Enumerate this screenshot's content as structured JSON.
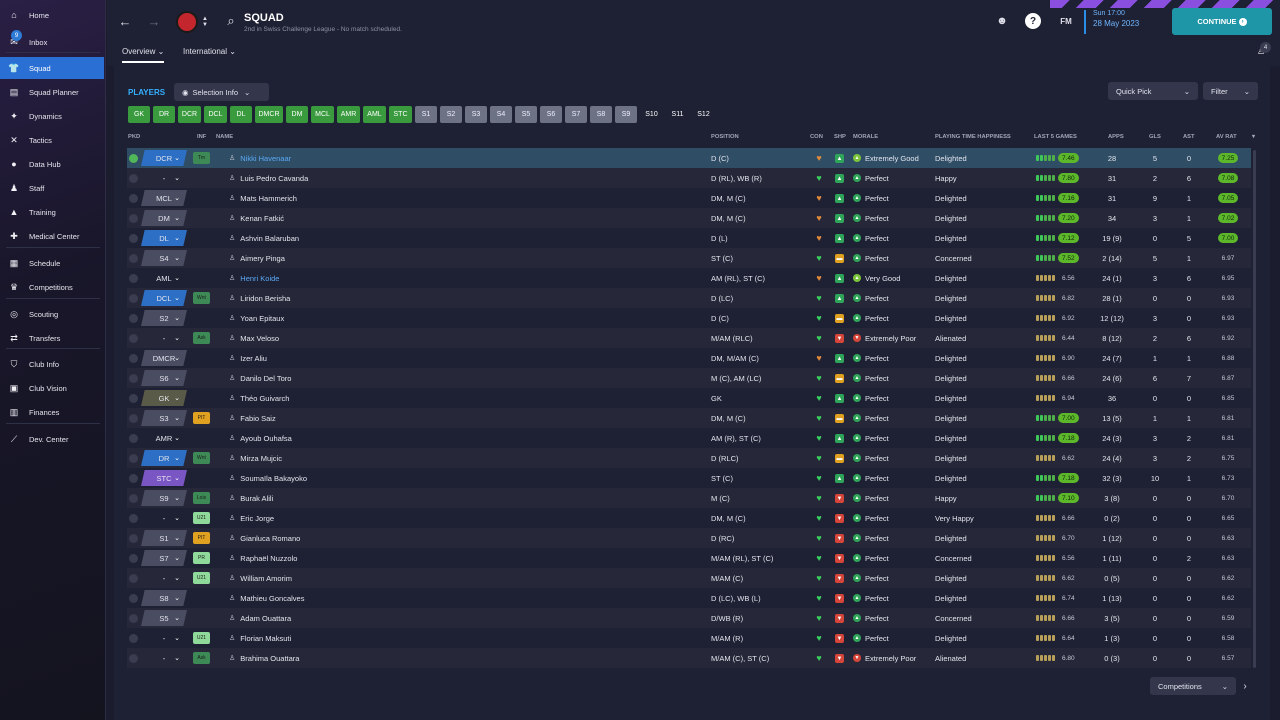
{
  "sidebar": {
    "items": [
      {
        "label": "Home",
        "icon": "home-icon",
        "glyph": "⌂"
      },
      {
        "label": "Inbox",
        "icon": "inbox-icon",
        "glyph": "✉",
        "badge": "9"
      },
      {
        "label": "Squad",
        "icon": "shirt-icon",
        "glyph": "👕",
        "active": true
      },
      {
        "label": "Squad Planner",
        "icon": "planner-icon",
        "glyph": "▤"
      },
      {
        "label": "Dynamics",
        "icon": "dynamics-icon",
        "glyph": "✦"
      },
      {
        "label": "Tactics",
        "icon": "tactics-icon",
        "glyph": "✕"
      },
      {
        "label": "Data Hub",
        "icon": "data-hub-icon",
        "glyph": "●"
      },
      {
        "label": "Staff",
        "icon": "staff-icon",
        "glyph": "♟"
      },
      {
        "label": "Training",
        "icon": "training-icon",
        "glyph": "▲"
      },
      {
        "label": "Medical Center",
        "icon": "medical-icon",
        "glyph": "✚"
      },
      {
        "label": "Schedule",
        "icon": "calendar-icon",
        "glyph": "▦"
      },
      {
        "label": "Competitions",
        "icon": "trophy-icon",
        "glyph": "♛"
      },
      {
        "label": "Scouting",
        "icon": "scouting-icon",
        "glyph": "◎"
      },
      {
        "label": "Transfers",
        "icon": "transfers-icon",
        "glyph": "⇄"
      },
      {
        "label": "Club Info",
        "icon": "shield-icon",
        "glyph": "⛉"
      },
      {
        "label": "Club Vision",
        "icon": "vision-icon",
        "glyph": "▣"
      },
      {
        "label": "Finances",
        "icon": "finances-icon",
        "glyph": "▥"
      },
      {
        "label": "Dev. Center",
        "icon": "dev-center-icon",
        "glyph": "⟋"
      }
    ]
  },
  "header": {
    "title": "SQUAD",
    "subtitle": "2nd in Swiss Challenge League - No match scheduled.",
    "tabs": [
      "Overview",
      "International"
    ],
    "fm_label": "FM",
    "date_day": "Sun 17:00",
    "date": "28 May 2023",
    "continue_label": "CONTINUE",
    "notification_count": "4"
  },
  "toolbar": {
    "players_label": "PLAYERS",
    "selection_info": "Selection Info",
    "quick_pick": "Quick Pick",
    "filter": "Filter",
    "competitions": "Competitions"
  },
  "position_chips": [
    {
      "label": "GK",
      "style": "g"
    },
    {
      "label": "DR",
      "style": "g"
    },
    {
      "label": "DCR",
      "style": "g"
    },
    {
      "label": "DCL",
      "style": "g"
    },
    {
      "label": "DL",
      "style": "g"
    },
    {
      "label": "DMCR",
      "style": "g"
    },
    {
      "label": "DM",
      "style": "g"
    },
    {
      "label": "MCL",
      "style": "g"
    },
    {
      "label": "AMR",
      "style": "g"
    },
    {
      "label": "AML",
      "style": "g"
    },
    {
      "label": "STC",
      "style": "g"
    },
    {
      "label": "S1",
      "style": "s"
    },
    {
      "label": "S2",
      "style": "s"
    },
    {
      "label": "S3",
      "style": "s"
    },
    {
      "label": "S4",
      "style": "s"
    },
    {
      "label": "S5",
      "style": "s"
    },
    {
      "label": "S6",
      "style": "s"
    },
    {
      "label": "S7",
      "style": "s"
    },
    {
      "label": "S8",
      "style": "s"
    },
    {
      "label": "S9",
      "style": "s"
    },
    {
      "label": "S10",
      "style": "n"
    },
    {
      "label": "S11",
      "style": "n"
    },
    {
      "label": "S12",
      "style": "n"
    }
  ],
  "columns": {
    "pkd": "PKD",
    "inf": "INF",
    "name": "NAME",
    "position": "POSITION",
    "con": "CON",
    "shp": "SHP",
    "morale": "MORALE",
    "happiness": "PLAYING TIME HAPPINESS",
    "last5": "LAST 5 GAMES",
    "apps": "APPS",
    "gls": "GLS",
    "ast": "AST",
    "avrat": "AV RAT"
  },
  "players": [
    {
      "tag": "DCR",
      "tag_color": "#2d6fc4",
      "inf": "Trn",
      "inf_color": "#3d8a56",
      "name": "Nikki Havenaar",
      "link": true,
      "pos": "D (C)",
      "shp": "up",
      "morale": "Extremely Good",
      "mc": "#7bc43a",
      "hap": "Delighted",
      "l5": "7.46",
      "l5c": "g",
      "apps": "28",
      "gls": "5",
      "ast": "0",
      "av": "7.25",
      "avc": "g",
      "sel": true
    },
    {
      "tag": "-",
      "tag_color": "",
      "inf": "",
      "inf_color": "",
      "name": "Luis Pedro Cavanda",
      "pos": "D (RL), WB (R)",
      "shp": "up",
      "morale": "Perfect",
      "mc": "#2fa55a",
      "hap": "Happy",
      "l5": "7.80",
      "l5c": "g",
      "apps": "31",
      "gls": "2",
      "ast": "6",
      "av": "7.08",
      "avc": "g"
    },
    {
      "tag": "MCL",
      "tag_color": "#4a4d62",
      "inf": "",
      "inf_color": "",
      "name": "Mats Hammerich",
      "pos": "DM, M (C)",
      "shp": "up",
      "morale": "Perfect",
      "mc": "#2fa55a",
      "hap": "Delighted",
      "l5": "7.16",
      "l5c": "g",
      "apps": "31",
      "gls": "9",
      "ast": "1",
      "av": "7.05",
      "avc": "g"
    },
    {
      "tag": "DM",
      "tag_color": "#4a4d62",
      "inf": "",
      "inf_color": "",
      "name": "Kenan Fatkić",
      "pos": "DM, M (C)",
      "shp": "up",
      "morale": "Perfect",
      "mc": "#2fa55a",
      "hap": "Delighted",
      "l5": "7.20",
      "l5c": "g",
      "apps": "34",
      "gls": "3",
      "ast": "1",
      "av": "7.02",
      "avc": "g"
    },
    {
      "tag": "DL",
      "tag_color": "#2d6fc4",
      "inf": "",
      "inf_color": "",
      "name": "Ashvin Balaruban",
      "pos": "D (L)",
      "shp": "up",
      "morale": "Perfect",
      "mc": "#2fa55a",
      "hap": "Delighted",
      "l5": "7.12",
      "l5c": "g",
      "apps": "19 (9)",
      "gls": "0",
      "ast": "5",
      "av": "7.00",
      "avc": "g"
    },
    {
      "tag": "S4",
      "tag_color": "#4a4d62",
      "inf": "",
      "inf_color": "",
      "name": "Aimery Pinga",
      "pos": "ST (C)",
      "shp": "mid",
      "morale": "Perfect",
      "mc": "#2fa55a",
      "hap": "Concerned",
      "l5": "7.52",
      "l5c": "g",
      "apps": "2 (14)",
      "gls": "5",
      "ast": "1",
      "av": "6.97",
      "avc": "n"
    },
    {
      "tag": "AML",
      "tag_color": "",
      "inf": "",
      "inf_color": "",
      "name": "Henri Koide",
      "link": true,
      "pos": "AM (RL), ST (C)",
      "shp": "up",
      "morale": "Very Good",
      "mc": "#7bc43a",
      "hap": "Delighted",
      "l5": "6.56",
      "l5c": "n",
      "apps": "24 (1)",
      "gls": "3",
      "ast": "6",
      "av": "6.95",
      "avc": "n"
    },
    {
      "tag": "DCL",
      "tag_color": "#2d6fc4",
      "inf": "Wnt",
      "inf_color": "#3d8a56",
      "name": "Liridon Berisha",
      "pos": "D (LC)",
      "shp": "up",
      "morale": "Perfect",
      "mc": "#2fa55a",
      "hap": "Delighted",
      "l5": "6.82",
      "l5c": "n",
      "apps": "28 (1)",
      "gls": "0",
      "ast": "0",
      "av": "6.93",
      "avc": "n"
    },
    {
      "tag": "S2",
      "tag_color": "#4a4d62",
      "inf": "",
      "inf_color": "",
      "name": "Yoan Epitaux",
      "pos": "D (C)",
      "shp": "mid",
      "morale": "Perfect",
      "mc": "#2fa55a",
      "hap": "Delighted",
      "l5": "6.92",
      "l5c": "n",
      "apps": "12 (12)",
      "gls": "3",
      "ast": "0",
      "av": "6.93",
      "avc": "n"
    },
    {
      "tag": "-",
      "tag_color": "",
      "inf": "Ask",
      "inf_color": "#3d8a56",
      "name": "Max Veloso",
      "pos": "M/AM (RLC)",
      "shp": "down",
      "morale": "Extremely Poor",
      "mc": "#d6453a",
      "hap": "Alienated",
      "l5": "6.44",
      "l5c": "n",
      "apps": "8 (12)",
      "gls": "2",
      "ast": "6",
      "av": "6.92",
      "avc": "n"
    },
    {
      "tag": "DMCR",
      "tag_color": "#4a4d62",
      "inf": "",
      "inf_color": "",
      "name": "Izer Aliu",
      "pos": "DM, M/AM (C)",
      "shp": "up",
      "morale": "Perfect",
      "mc": "#2fa55a",
      "hap": "Delighted",
      "l5": "6.90",
      "l5c": "n",
      "apps": "24 (7)",
      "gls": "1",
      "ast": "1",
      "av": "6.88",
      "avc": "n"
    },
    {
      "tag": "S6",
      "tag_color": "#4a4d62",
      "inf": "",
      "inf_color": "",
      "name": "Danilo Del Toro",
      "pos": "M (C), AM (LC)",
      "shp": "mid",
      "morale": "Perfect",
      "mc": "#2fa55a",
      "hap": "Delighted",
      "l5": "6.66",
      "l5c": "n",
      "apps": "24 (6)",
      "gls": "6",
      "ast": "7",
      "av": "6.87",
      "avc": "n"
    },
    {
      "tag": "GK",
      "tag_color": "#5a5a48",
      "inf": "",
      "inf_color": "",
      "name": "Théo Guivarch",
      "pos": "GK",
      "shp": "up",
      "morale": "Perfect",
      "mc": "#2fa55a",
      "hap": "Delighted",
      "l5": "6.94",
      "l5c": "n",
      "apps": "36",
      "gls": "0",
      "ast": "0",
      "av": "6.85",
      "avc": "n"
    },
    {
      "tag": "S3",
      "tag_color": "#4a4d62",
      "inf": "PIT",
      "inf_color": "#e0a020",
      "name": "Fabio Saiz",
      "pos": "DM, M (C)",
      "shp": "mid",
      "morale": "Perfect",
      "mc": "#2fa55a",
      "hap": "Delighted",
      "l5": "7.00",
      "l5c": "g",
      "apps": "13 (5)",
      "gls": "1",
      "ast": "1",
      "av": "6.81",
      "avc": "n"
    },
    {
      "tag": "AMR",
      "tag_color": "",
      "inf": "",
      "inf_color": "",
      "name": "Ayoub Ouhafsa",
      "pos": "AM (R), ST (C)",
      "shp": "up",
      "morale": "Perfect",
      "mc": "#2fa55a",
      "hap": "Delighted",
      "l5": "7.18",
      "l5c": "g",
      "apps": "24 (3)",
      "gls": "3",
      "ast": "2",
      "av": "6.81",
      "avc": "n"
    },
    {
      "tag": "DR",
      "tag_color": "#2d6fc4",
      "inf": "Wnt",
      "inf_color": "#3d8a56",
      "name": "Mirza Mujcic",
      "pos": "D (RLC)",
      "shp": "mid",
      "morale": "Perfect",
      "mc": "#2fa55a",
      "hap": "Delighted",
      "l5": "6.62",
      "l5c": "n",
      "apps": "24 (4)",
      "gls": "3",
      "ast": "2",
      "av": "6.75",
      "avc": "n"
    },
    {
      "tag": "STC",
      "tag_color": "#7a55c4",
      "inf": "",
      "inf_color": "",
      "name": "Soumaïla Bakayoko",
      "pos": "ST (C)",
      "shp": "up",
      "morale": "Perfect",
      "mc": "#2fa55a",
      "hap": "Delighted",
      "l5": "7.18",
      "l5c": "g",
      "apps": "32 (3)",
      "gls": "10",
      "ast": "1",
      "av": "6.73",
      "avc": "n"
    },
    {
      "tag": "S9",
      "tag_color": "#4a4d62",
      "inf": "Lois",
      "inf_color": "#3d8a56",
      "name": "Burak Alili",
      "pos": "M (C)",
      "shp": "down",
      "morale": "Perfect",
      "mc": "#2fa55a",
      "hap": "Happy",
      "l5": "7.10",
      "l5c": "g",
      "apps": "3 (8)",
      "gls": "0",
      "ast": "0",
      "av": "6.70",
      "avc": "n"
    },
    {
      "tag": "-",
      "tag_color": "",
      "inf": "U21",
      "inf_color": "#8fd99a",
      "name": "Eric Jorge",
      "pos": "DM, M (C)",
      "shp": "down",
      "morale": "Perfect",
      "mc": "#2fa55a",
      "hap": "Very Happy",
      "l5": "6.66",
      "l5c": "n",
      "apps": "0 (2)",
      "gls": "0",
      "ast": "0",
      "av": "6.65",
      "avc": "n"
    },
    {
      "tag": "S1",
      "tag_color": "#4a4d62",
      "inf": "PIT",
      "inf_color": "#e0a020",
      "name": "Gianluca Romano",
      "pos": "D (RC)",
      "shp": "down",
      "morale": "Perfect",
      "mc": "#2fa55a",
      "hap": "Delighted",
      "l5": "6.70",
      "l5c": "n",
      "apps": "1 (12)",
      "gls": "0",
      "ast": "0",
      "av": "6.63",
      "avc": "n"
    },
    {
      "tag": "S7",
      "tag_color": "#4a4d62",
      "inf": "PR",
      "inf_color": "#8fd99a",
      "name": "Raphaël Nuzzolo",
      "pos": "M/AM (RL), ST (C)",
      "shp": "down",
      "morale": "Perfect",
      "mc": "#2fa55a",
      "hap": "Concerned",
      "l5": "6.56",
      "l5c": "n",
      "apps": "1 (11)",
      "gls": "0",
      "ast": "2",
      "av": "6.63",
      "avc": "n"
    },
    {
      "tag": "-",
      "tag_color": "",
      "inf": "U21",
      "inf_color": "#8fd99a",
      "name": "William Amorim",
      "pos": "M/AM (C)",
      "shp": "down",
      "morale": "Perfect",
      "mc": "#2fa55a",
      "hap": "Delighted",
      "l5": "6.62",
      "l5c": "n",
      "apps": "0 (5)",
      "gls": "0",
      "ast": "0",
      "av": "6.62",
      "avc": "n"
    },
    {
      "tag": "S8",
      "tag_color": "#4a4d62",
      "inf": "",
      "inf_color": "",
      "name": "Mathieu Goncalves",
      "pos": "D (LC), WB (L)",
      "shp": "down",
      "morale": "Perfect",
      "mc": "#2fa55a",
      "hap": "Delighted",
      "l5": "6.74",
      "l5c": "n",
      "apps": "1 (13)",
      "gls": "0",
      "ast": "0",
      "av": "6.62",
      "avc": "n"
    },
    {
      "tag": "S5",
      "tag_color": "#4a4d62",
      "inf": "",
      "inf_color": "",
      "name": "Adam Ouattara",
      "pos": "D/WB (R)",
      "shp": "down",
      "morale": "Perfect",
      "mc": "#2fa55a",
      "hap": "Concerned",
      "l5": "6.66",
      "l5c": "n",
      "apps": "3 (5)",
      "gls": "0",
      "ast": "0",
      "av": "6.59",
      "avc": "n"
    },
    {
      "tag": "-",
      "tag_color": "",
      "inf": "U21",
      "inf_color": "#8fd99a",
      "name": "Florian Maksuti",
      "pos": "M/AM (R)",
      "shp": "down",
      "morale": "Perfect",
      "mc": "#2fa55a",
      "hap": "Delighted",
      "l5": "6.64",
      "l5c": "n",
      "apps": "1 (3)",
      "gls": "0",
      "ast": "0",
      "av": "6.58",
      "avc": "n"
    },
    {
      "tag": "-",
      "tag_color": "",
      "inf": "Ask",
      "inf_color": "#3d8a56",
      "name": "Brahima Ouattara",
      "pos": "M/AM (C), ST (C)",
      "shp": "down",
      "morale": "Extremely Poor",
      "mc": "#d6453a",
      "hap": "Alienated",
      "l5": "6.80",
      "l5c": "n",
      "apps": "0 (3)",
      "gls": "0",
      "ast": "0",
      "av": "6.57",
      "avc": "n"
    }
  ]
}
